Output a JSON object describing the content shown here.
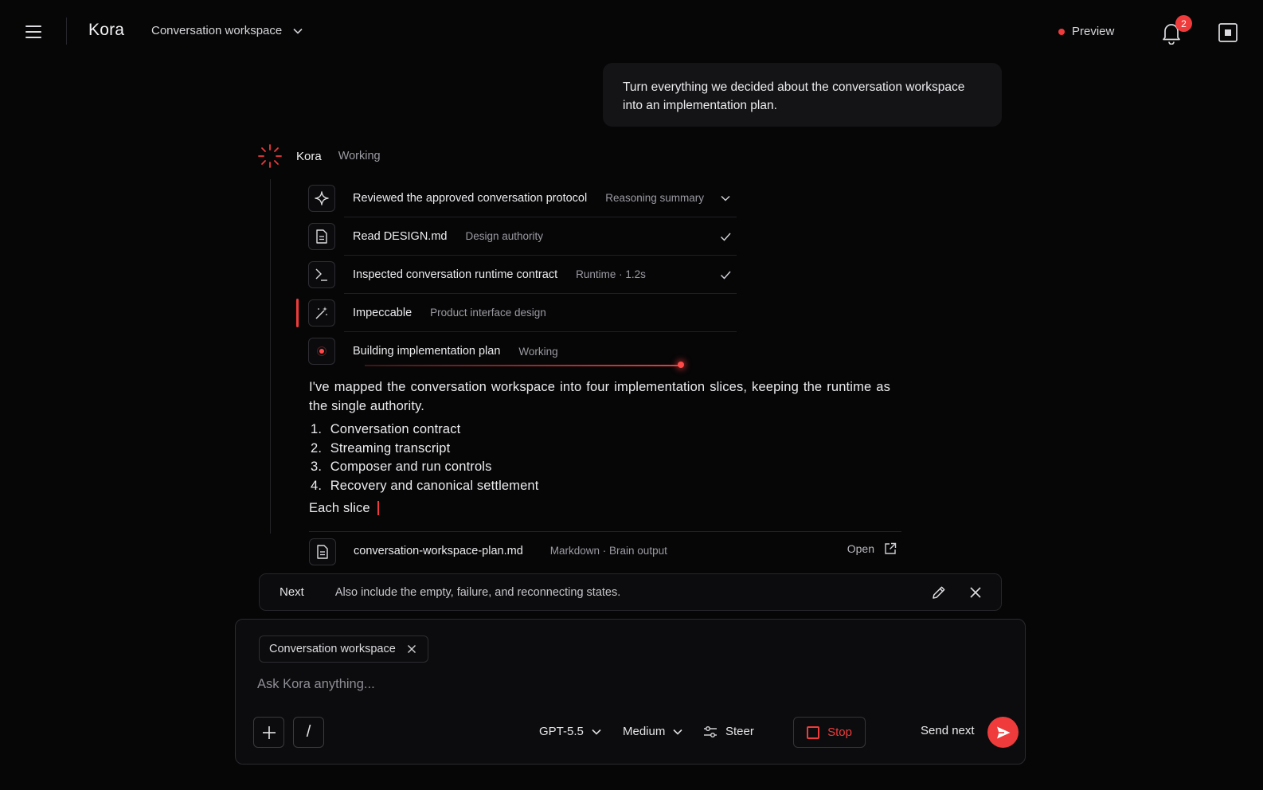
{
  "app": {
    "brand": "Kora",
    "workspace": "Conversation workspace",
    "preview_label": "Preview",
    "notification_count": "2"
  },
  "colors": {
    "background": "#060607",
    "accent": "#ef3b3b",
    "surface": "#141417",
    "muted_text": "#9b9ba2"
  },
  "user_message": {
    "line1": "Turn everything we decided about the conversation workspace",
    "line2": "into an implementation plan."
  },
  "assistant": {
    "name": "Kora",
    "status": "Working",
    "steps": [
      {
        "icon": "sparkle-icon",
        "title": "Reviewed the approved conversation protocol",
        "meta": "Reasoning summary",
        "end": "chevron-down-icon"
      },
      {
        "icon": "document-icon",
        "title": "Read DESIGN.md",
        "meta": "Design authority",
        "end": "check-icon"
      },
      {
        "icon": "terminal-icon",
        "title": "Inspected conversation runtime contract",
        "meta": "Runtime · 1.2s",
        "end": "check-icon"
      },
      {
        "icon": "magic-wand-icon",
        "title": "Impeccable",
        "meta": "Product interface design",
        "end": ""
      },
      {
        "icon": "pulse-dot-icon",
        "title": "Building implementation plan",
        "meta": "Working",
        "end": ""
      }
    ],
    "intro": "I've mapped the conversation workspace into four implementation slices, keeping the runtime as the single authority.",
    "slices": [
      {
        "num": "1.",
        "text": "Conversation contract"
      },
      {
        "num": "2.",
        "text": "Streaming transcript"
      },
      {
        "num": "3.",
        "text": "Composer and run controls"
      },
      {
        "num": "4.",
        "text": "Recovery and canonical settlement"
      }
    ],
    "streaming_text": "Each slice"
  },
  "artifact": {
    "icon": "document-icon",
    "filename": "conversation-workspace-plan.md",
    "meta": "Markdown · Brain output",
    "open_label": "Open"
  },
  "queued": {
    "label": "Next",
    "text": "Also include the empty, failure, and reconnecting states."
  },
  "composer": {
    "chip": "Conversation workspace",
    "placeholder": "Ask Kora anything...",
    "model": "GPT-5.5",
    "effort": "Medium",
    "steer_label": "Steer",
    "stop_label": "Stop",
    "send_label": "Send next",
    "slash_label": "/"
  }
}
